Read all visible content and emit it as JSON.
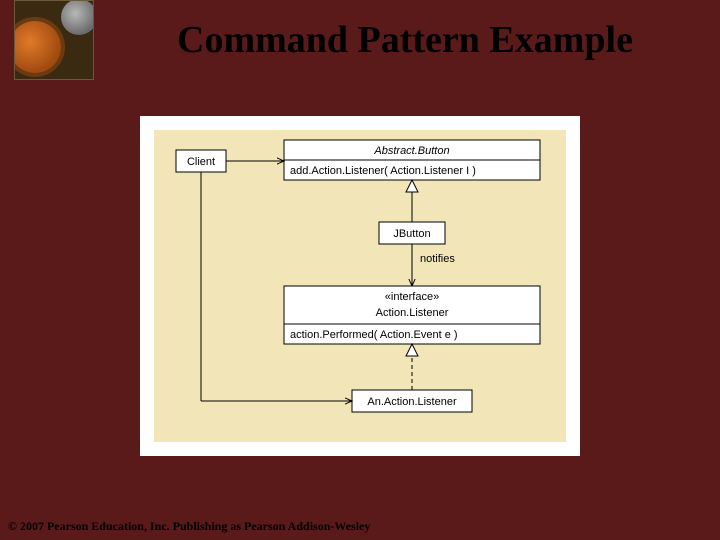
{
  "title": "Command Pattern Example",
  "copyright": "© 2007 Pearson Education, Inc. Publishing as Pearson Addison-Wesley",
  "diagram": {
    "client": "Client",
    "abstractButton": {
      "name": "Abstract.Button",
      "method": "add.Action.Listener( Action.Listener I )"
    },
    "jbutton": "JButton",
    "notifies": "notifies",
    "actionListener": {
      "stereotype": "«interface»",
      "name": "Action.Listener",
      "method": "action.Performed( Action.Event e )"
    },
    "anActionListener": "An.Action.Listener"
  }
}
